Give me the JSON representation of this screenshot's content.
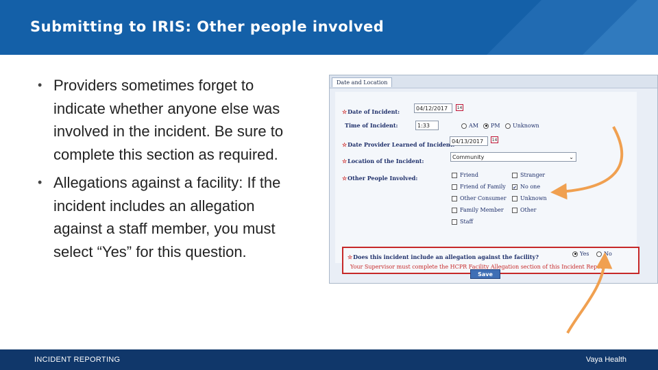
{
  "header": {
    "title": "Submitting to IRIS: Other people involved"
  },
  "bullets": [
    "Providers sometimes forget to indicate whether anyone else was involved in the incident. Be sure to complete this section as required.",
    "Allegations against a facility: If the incident includes an allegation against a staff member, you must select “Yes” for this question."
  ],
  "form": {
    "tab": "Date and Location",
    "date_of_incident": {
      "label": "Date of Incident:",
      "value": "04/12/2017"
    },
    "time_of_incident": {
      "label": "Time of Incident:",
      "value": "1:33",
      "options": [
        "AM",
        "PM",
        "Unknown"
      ],
      "selected": "PM"
    },
    "date_learned": {
      "label": "Date Provider Learned of Incident:",
      "value": "04/13/2017"
    },
    "location": {
      "label": "Location of the Incident:",
      "value": "Community"
    },
    "other_people": {
      "label": "Other People Involved:",
      "col1": [
        "Friend",
        "Friend of Family",
        "Other Consumer",
        "Family Member",
        "Staff"
      ],
      "col2": [
        "Stranger",
        "No one",
        "Unknown",
        "Other"
      ],
      "checked": "No one"
    },
    "allegation": {
      "question": "Does this incident include an allegation against the facility?",
      "yes": "Yes",
      "no": "No",
      "selected": "Yes",
      "warning": "Your Supervisor must complete the HCPR Facility Allegation section of this Incident Report"
    },
    "save_label": "Save",
    "calendar_icon_text": "14"
  },
  "footer": {
    "left": "INCIDENT REPORTING",
    "right": "Vaya Health"
  },
  "colors": {
    "header": "#1460a8",
    "footer": "#10376a",
    "arrow": "#f0a050",
    "alert": "#c62828"
  }
}
